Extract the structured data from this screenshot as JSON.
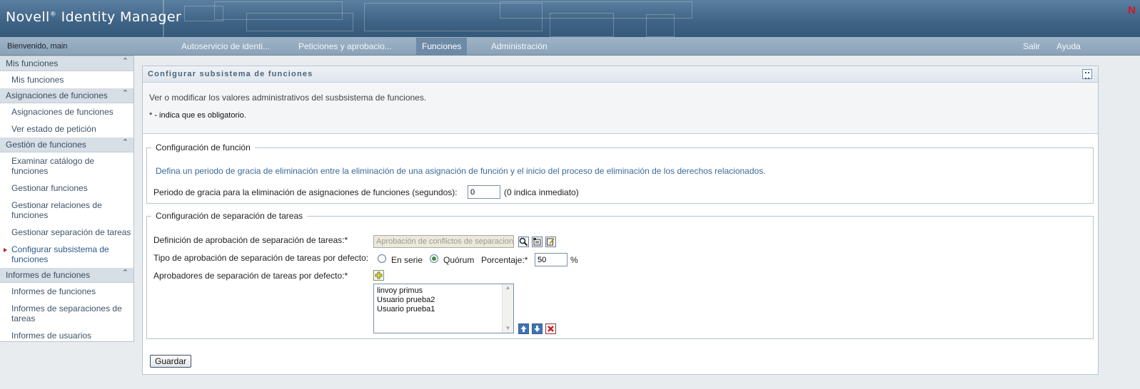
{
  "app": {
    "brand": "Novell",
    "brand_reg": "®",
    "brand_rest": " Identity Manager",
    "logo_letter": "N"
  },
  "nav": {
    "welcome": "Bienvenido, main",
    "tabs": [
      {
        "label": "Autoservicio de identi..."
      },
      {
        "label": "Peticiones y aprobacio..."
      },
      {
        "label": "Funciones",
        "active": true
      },
      {
        "label": "Administración"
      }
    ],
    "logout": "Salir",
    "help": "Ayuda"
  },
  "sidebar": {
    "sections": [
      {
        "title": "Mis funciones",
        "items": [
          "Mis funciones"
        ]
      },
      {
        "title": "Asignaciones de funciones",
        "items": [
          "Asignaciones de funciones",
          "Ver estado de petición"
        ]
      },
      {
        "title": "Gestión de funciones",
        "items": [
          "Examinar catálogo de funciones",
          "Gestionar funciones",
          "Gestionar relaciones de funciones",
          "Gestionar separación de tareas",
          "Configurar subsistema de funciones"
        ]
      },
      {
        "title": "Informes de funciones",
        "items": [
          "Informes de funciones",
          "Informes de separaciones de tareas",
          "Informes de usuarios"
        ]
      }
    ]
  },
  "panel": {
    "title": "Configurar subsistema de funciones",
    "description": "Ver o modificar los valores administrativos del susbsistema de funciones.",
    "required_note": "* - indica que es obligatorio."
  },
  "role_config": {
    "legend": "Configuración de función",
    "info": "Defina un periodo de gracia de eliminación entre la eliminación de una asignación de función y el inicio del proceso de eliminación de los derechos relacionados.",
    "grace_label": "Periodo de gracia para la eliminación de asignaciones de funciones (segundos):",
    "grace_value": "0",
    "grace_hint": "(0 indica inmediato)"
  },
  "sod_config": {
    "legend": "Configuración de separación de tareas",
    "approval_def_label": "Definición de aprobación de separación de tareas:*",
    "approval_def_value": "Aprobación de conflictos de separaciones",
    "approval_type_label": "Tipo de aprobación de separación de tareas por defecto:",
    "option_serial": "En serie",
    "option_quorum": "Quórum",
    "selected_option": "Quórum",
    "percent_label": "Porcentaje:*",
    "percent_value": "50",
    "percent_unit": "%",
    "approvers_label": "Aprobadores de separación de tareas por defecto:*",
    "approvers": [
      "linvoy primus",
      "Usuario prueba2",
      "Usuario prueba1"
    ]
  },
  "actions": {
    "save": "Guardar"
  },
  "colors": {
    "banner": "#3e6384",
    "nav_active": "#6d8aa6",
    "accent_blue": "#3b6a9a",
    "current_marker": "#c0202a"
  }
}
